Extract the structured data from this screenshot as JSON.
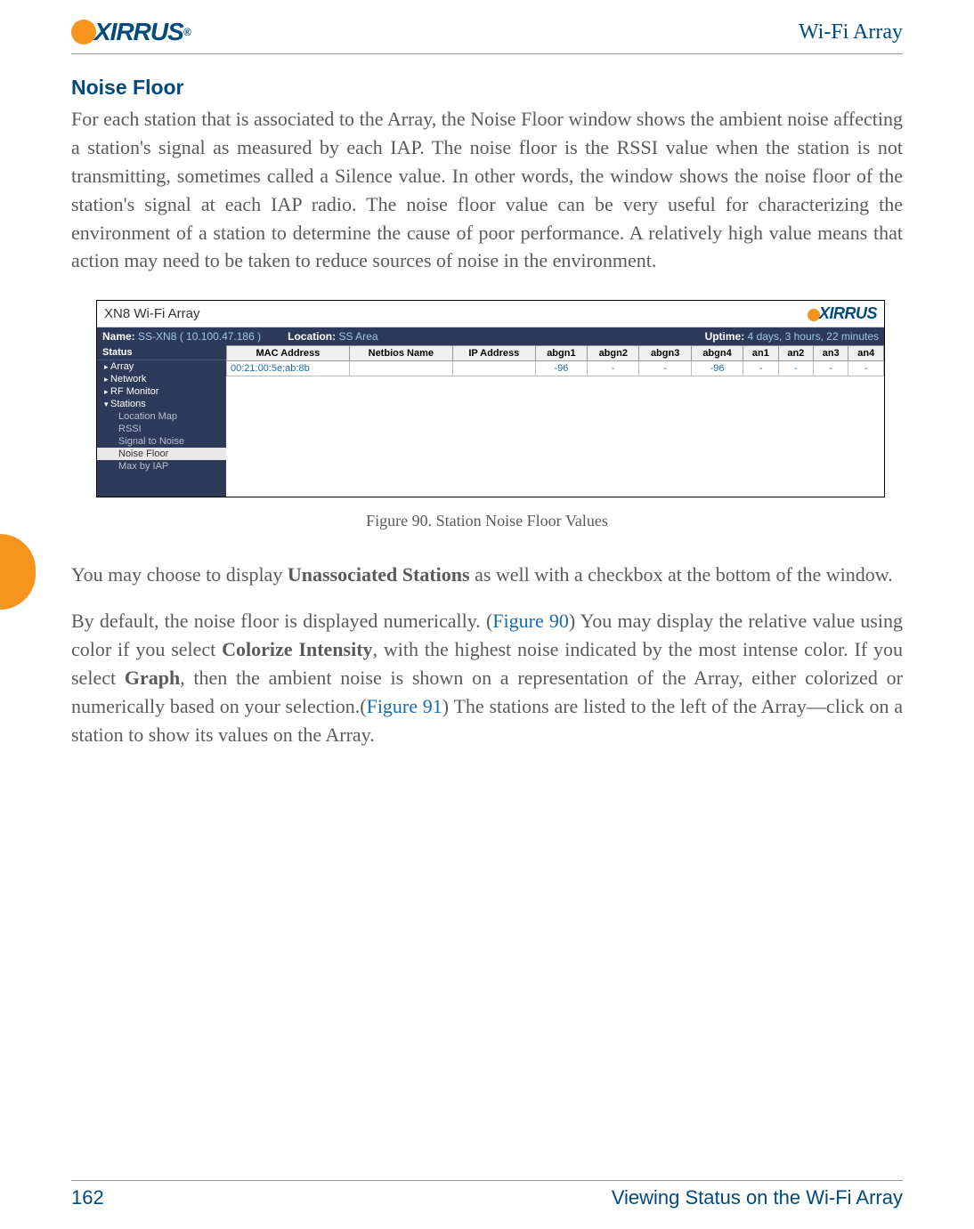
{
  "header": {
    "brand": "XIRRUS",
    "product": "Wi-Fi Array"
  },
  "section": {
    "title": "Noise Floor",
    "para1": "For each station that is associated to the Array, the Noise Floor window shows the ambient noise affecting a station's signal as measured by each IAP. The noise floor is the RSSI value when the station is not transmitting, sometimes called a Silence value. In other words, the window shows the noise floor of the station's signal at each IAP radio. The noise floor value can be very useful for characterizing the environment of a station to determine the cause of poor performance. A relatively high value means that action may need to be taken to reduce sources of noise in the environment.",
    "para2_pre": "You may choose to display ",
    "para2_bold": "Unassociated Stations",
    "para2_post": " as well with a checkbox at the bottom of the window.",
    "para3_a": "By default, the noise floor is displayed numerically. (",
    "para3_link1": "Figure 90",
    "para3_b": ") You may display the relative value using color if you select ",
    "para3_bold1": "Colorize Intensity",
    "para3_c": ", with the highest noise indicated by the most intense color. If you select ",
    "para3_bold2": "Graph",
    "para3_d": ", then the ambient noise is shown on a representation of the Array, either colorized or numerically based on your selection.(",
    "para3_link2": "Figure 91",
    "para3_e": ") The stations are listed to the left of the Array—click on a station to show its values on the Array."
  },
  "figure": {
    "app_title": "XN8 Wi-Fi Array",
    "brand": "XIRRUS",
    "statusbar": {
      "name_lbl": "Name:",
      "name_val": "SS-XN8   ( 10.100.47.186 )",
      "loc_lbl": "Location:",
      "loc_val": "SS Area",
      "up_lbl": "Uptime:",
      "up_val": "4 days, 3 hours, 22 minutes"
    },
    "sidebar": {
      "header": "Status",
      "items": [
        "Array",
        "Network",
        "RF Monitor",
        "Stations"
      ],
      "subitems": [
        "Location Map",
        "RSSI",
        "Signal to Noise",
        "Noise Floor",
        "Max by IAP"
      ]
    },
    "table": {
      "headers": [
        "MAC Address",
        "Netbios Name",
        "IP Address",
        "abgn1",
        "abgn2",
        "abgn3",
        "abgn4",
        "an1",
        "an2",
        "an3",
        "an4"
      ],
      "row": {
        "mac": "00:21:00:5e:ab:8b",
        "netbios": "",
        "ip": "",
        "abgn1": "-96",
        "abgn2": "-",
        "abgn3": "-",
        "abgn4": "-96",
        "an1": "-",
        "an2": "-",
        "an3": "-",
        "an4": "-"
      }
    },
    "caption": "Figure 90. Station Noise Floor Values"
  },
  "footer": {
    "page": "162",
    "section": "Viewing Status on the Wi-Fi Array"
  }
}
